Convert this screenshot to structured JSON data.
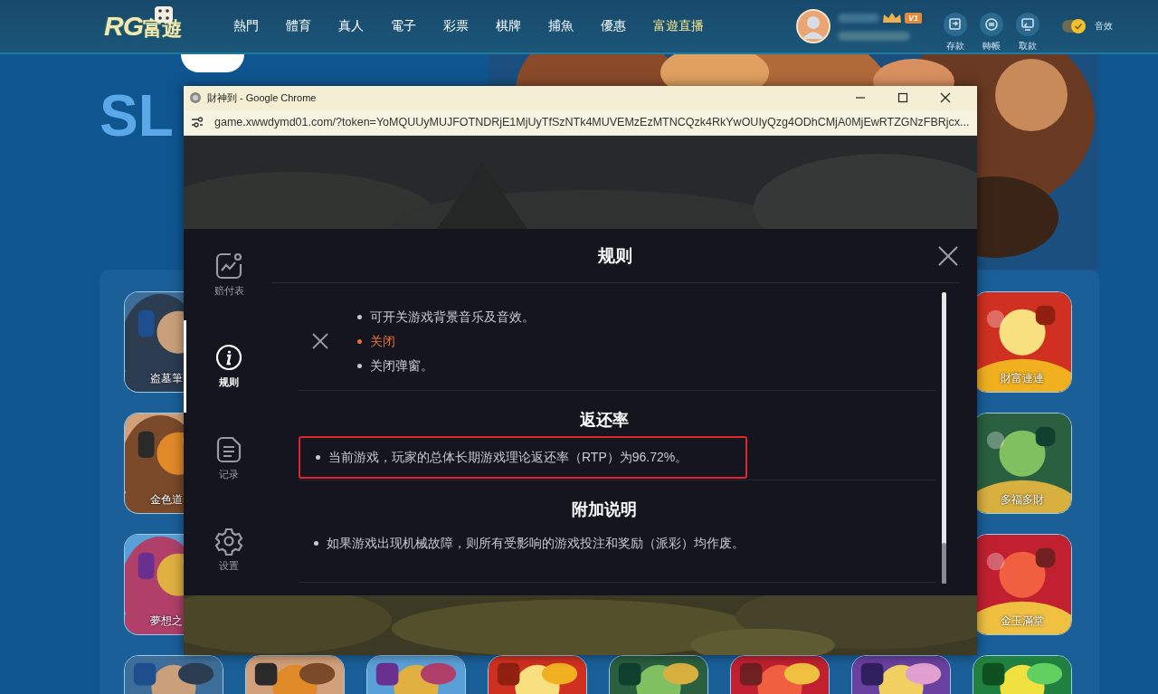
{
  "header": {
    "logo": {
      "latin": "RG",
      "cjk": "富遊"
    },
    "nav": [
      {
        "label": "熱門",
        "highlighted": false
      },
      {
        "label": "體育",
        "highlighted": false
      },
      {
        "label": "真人",
        "highlighted": false
      },
      {
        "label": "電子",
        "highlighted": false
      },
      {
        "label": "彩票",
        "highlighted": false
      },
      {
        "label": "棋牌",
        "highlighted": false
      },
      {
        "label": "捕魚",
        "highlighted": false
      },
      {
        "label": "優惠",
        "highlighted": false
      },
      {
        "label": "富遊直播",
        "highlighted": true
      }
    ],
    "vip_badge": "V1",
    "actions": [
      {
        "label": "存款",
        "kind": "deposit"
      },
      {
        "label": "轉帳",
        "kind": "transfer"
      },
      {
        "label": "取款",
        "kind": "withdraw"
      }
    ],
    "sound_toggle": {
      "label": "音效",
      "on": true
    }
  },
  "hero": {
    "title": "SL"
  },
  "games": {
    "side_rows": [
      {
        "left": "盗墓筆",
        "right": "財富連連"
      },
      {
        "left": "金色道",
        "right": "多福多財"
      },
      {
        "left": "夢想之",
        "right": "金玉滿堂"
      }
    ]
  },
  "browser": {
    "title": "財神到 - Google Chrome",
    "url": "game.xwwdymd01.com/?token=YoMQUUyMUJFOTNDRjE1MjUyTfSzNTk4MUVEMzEzMTNCQzk4RkYwOUIyQzg4ODhCMjA0MjEwRTZGNzFBRjcx..."
  },
  "modal": {
    "title": "规则",
    "tabs": [
      {
        "label": "赔付表",
        "kind": "paytable",
        "selected": false
      },
      {
        "label": "规则",
        "kind": "rules",
        "selected": true
      },
      {
        "label": "记录",
        "kind": "history",
        "selected": false
      },
      {
        "label": "设置",
        "kind": "settings",
        "selected": false
      }
    ],
    "sections": [
      {
        "kind": "icon_legend",
        "highlighted": false,
        "items": [
          {
            "text": "可开关游戏背景音乐及音效。",
            "kind": "bullet"
          },
          {
            "text": "关闭",
            "kind": "accent"
          },
          {
            "text": "关闭弹窗。",
            "kind": "bullet"
          }
        ]
      },
      {
        "kind": "text",
        "heading": "返还率",
        "highlighted": true,
        "items": [
          {
            "text": "当前游戏，玩家的总体长期游戏理论返还率（RTP）为96.72%。",
            "kind": "bullet"
          }
        ]
      },
      {
        "kind": "text",
        "heading": "附加说明",
        "highlighted": false,
        "items": [
          {
            "text": "如果游戏出现机械故障，则所有受影响的游戏投注和奖励（派彩）均作废。",
            "kind": "bullet"
          }
        ]
      }
    ]
  }
}
